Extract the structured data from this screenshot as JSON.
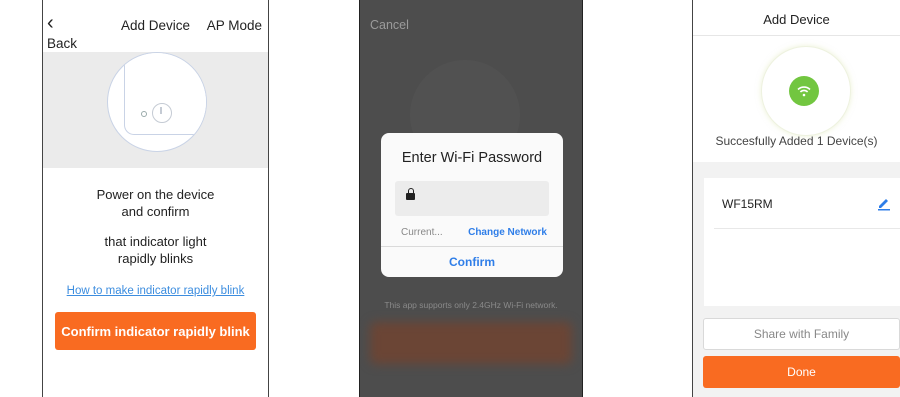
{
  "screen1": {
    "back_label": "Back",
    "title": "Add Device",
    "ap_mode": "AP Mode",
    "instruction_line1": "Power on the device",
    "instruction_line2": "and confirm",
    "instruction_line3": "that indicator light",
    "instruction_line4": "rapidly blinks",
    "help_link": "How to make indicator rapidly blink",
    "confirm_button": "Confirm indicator rapidly blink",
    "icons": {
      "back": "chevron-left-icon",
      "power": "power-icon"
    }
  },
  "screen2": {
    "cancel": "Cancel",
    "dialog_title": "Enter Wi-Fi Password",
    "current_network": "Current...",
    "change_network": "Change Network",
    "confirm": "Confirm",
    "support_note": "This app supports only 2.4GHz Wi-Fi network.",
    "icons": {
      "password": "lock-icon"
    }
  },
  "screen3": {
    "title": "Add Device",
    "success_text": "Succesfully Added 1 Device(s)",
    "device_name": "WF15RM",
    "share_button": "Share with Family",
    "done_button": "Done",
    "icons": {
      "status": "wifi-icon",
      "edit": "pencil-icon"
    }
  },
  "colors": {
    "accent_orange": "#f96b21",
    "link_blue": "#3c8ddf",
    "dialog_blue": "#2f7ee8",
    "success_green": "#72c640"
  }
}
